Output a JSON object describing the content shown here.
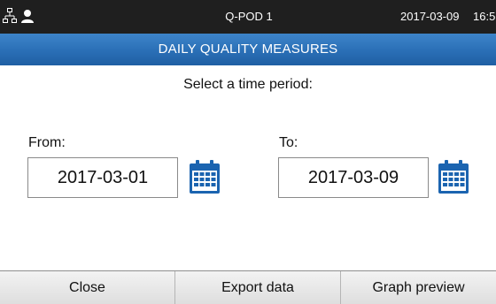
{
  "status_bar": {
    "device_name": "Q-POD 1",
    "date": "2017-03-09",
    "time": "16:5",
    "icons": [
      "network-icon",
      "user-icon"
    ]
  },
  "header": {
    "title": "DAILY QUALITY MEASURES"
  },
  "main": {
    "prompt": "Select a time period:",
    "from": {
      "label": "From:",
      "value": "2017-03-01",
      "icon": "calendar-icon"
    },
    "to": {
      "label": "To:",
      "value": "2017-03-09",
      "icon": "calendar-icon"
    }
  },
  "footer": {
    "buttons": [
      {
        "label": "Close"
      },
      {
        "label": "Export data"
      },
      {
        "label": "Graph preview"
      }
    ]
  },
  "colors": {
    "status_bar_bg": "#1f1f1f",
    "title_bar_bg": "#2a6fb6",
    "calendar_icon": "#1b64b0"
  }
}
